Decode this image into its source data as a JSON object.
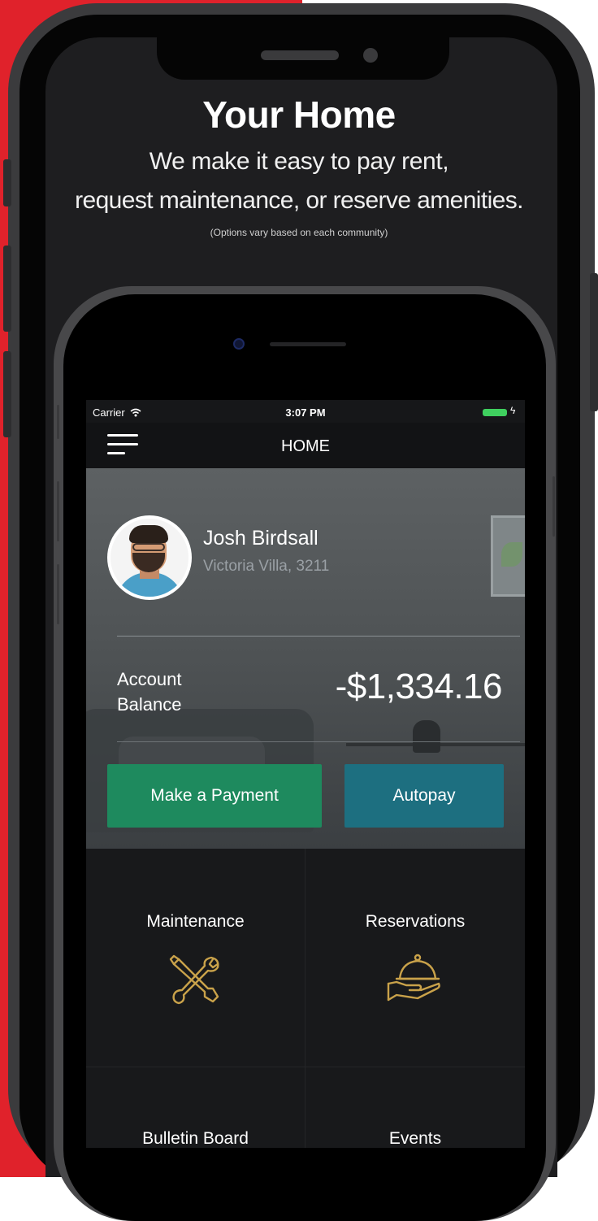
{
  "promo": {
    "title": "Your Home",
    "subtitle_line1": "We make it easy to pay rent,",
    "subtitle_line2": "request maintenance, or reserve amenities.",
    "note": "(Options vary based on each community)",
    "background_accent": "#e0222b"
  },
  "status_bar": {
    "carrier": "Carrier",
    "wifi_icon": "wifi-icon",
    "time": "3:07 PM",
    "battery_icon": "battery-icon",
    "battery_color": "#3fd05f"
  },
  "nav": {
    "menu_icon": "hamburger-menu-icon",
    "title": "HOME"
  },
  "profile": {
    "name": "Josh Birdsall",
    "unit": "Victoria Villa, 3211"
  },
  "account": {
    "label_line1": "Account",
    "label_line2": "Balance",
    "balance": "-$1,334.16"
  },
  "actions": {
    "pay_label": "Make a Payment",
    "pay_color": "#1e8a5e",
    "autopay_label": "Autopay",
    "autopay_color": "#1d6f80"
  },
  "tiles": [
    {
      "label": "Maintenance",
      "icon": "tools-icon"
    },
    {
      "label": "Reservations",
      "icon": "cloche-icon"
    },
    {
      "label": "Bulletin Board",
      "icon": ""
    },
    {
      "label": "Events",
      "icon": ""
    }
  ],
  "icon_color": "#c9a24a"
}
